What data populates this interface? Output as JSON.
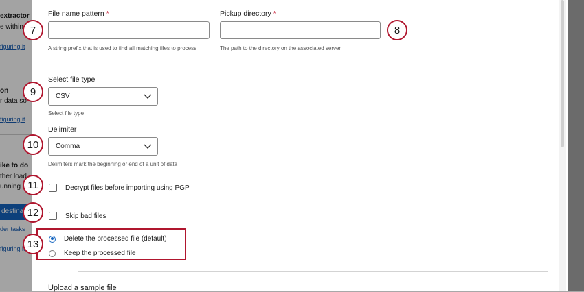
{
  "background": {
    "items": [
      {
        "text": "extractor",
        "style": "bold"
      },
      {
        "text": "e within",
        "style": "normal"
      },
      {
        "text": "figuring it",
        "style": "link"
      },
      {
        "text": "on",
        "style": "bold"
      },
      {
        "text": "r data so",
        "style": "normal"
      },
      {
        "text": "figuring it",
        "style": "link"
      },
      {
        "text": "ike to do",
        "style": "bold"
      },
      {
        "text": "ther load",
        "style": "normal"
      },
      {
        "text": "unning",
        "style": "normal"
      },
      {
        "text": "der tasks",
        "style": "link"
      },
      {
        "text": "figuring it",
        "style": "link"
      }
    ],
    "button_label": "destina"
  },
  "form": {
    "file_name_pattern": {
      "label": "File name pattern",
      "required_mark": "*",
      "value": "",
      "help": "A string prefix that is used to find all matching files to process"
    },
    "pickup_directory": {
      "label": "Pickup directory",
      "required_mark": "*",
      "value": "",
      "help": "The path to the directory on the associated server"
    },
    "file_type": {
      "label": "Select file type",
      "selected": "CSV",
      "help": "Select file type"
    },
    "delimiter": {
      "label": "Delimiter",
      "selected": "Comma",
      "help": "Delimiters mark the beginning or end of a unit of data"
    },
    "decrypt_checkbox": {
      "label": "Decrypt files before importing using PGP",
      "checked": false
    },
    "skip_bad_checkbox": {
      "label": "Skip bad files",
      "checked": false
    },
    "processed_file_options": [
      {
        "label": "Delete the processed file (default)",
        "selected": true
      },
      {
        "label": "Keep the processed file",
        "selected": false
      }
    ],
    "upload_section_title": "Upload a sample file"
  },
  "callouts": [
    "7",
    "8",
    "9",
    "10",
    "11",
    "12",
    "13"
  ],
  "colors": {
    "callout_border": "#b0162e",
    "required": "#c4142d",
    "radio_selected": "#1565c0",
    "button": "#1565c0"
  }
}
